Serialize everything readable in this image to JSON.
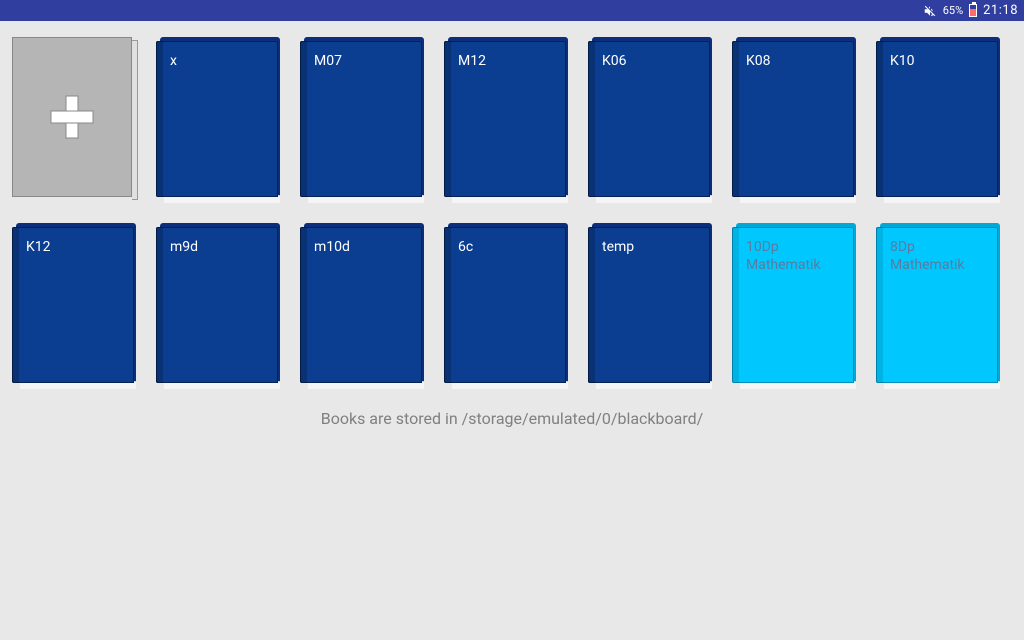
{
  "status": {
    "battery_percent": "65%",
    "time": "21:18"
  },
  "books": [
    {
      "label": "x",
      "variant": "dark"
    },
    {
      "label": "M07",
      "variant": "dark"
    },
    {
      "label": "M12",
      "variant": "dark"
    },
    {
      "label": "K06",
      "variant": "dark"
    },
    {
      "label": "K08",
      "variant": "dark"
    },
    {
      "label": "K10",
      "variant": "dark"
    },
    {
      "label": "K12",
      "variant": "dark"
    },
    {
      "label": "m9d",
      "variant": "dark"
    },
    {
      "label": "m10d",
      "variant": "dark"
    },
    {
      "label": "6c",
      "variant": "dark"
    },
    {
      "label": "temp",
      "variant": "dark"
    },
    {
      "label": "10Dp Mathematik",
      "variant": "light"
    },
    {
      "label": "8Dp Mathematik",
      "variant": "light"
    }
  ],
  "storage_line": "Books are stored in /storage/emulated/0/blackboard/"
}
